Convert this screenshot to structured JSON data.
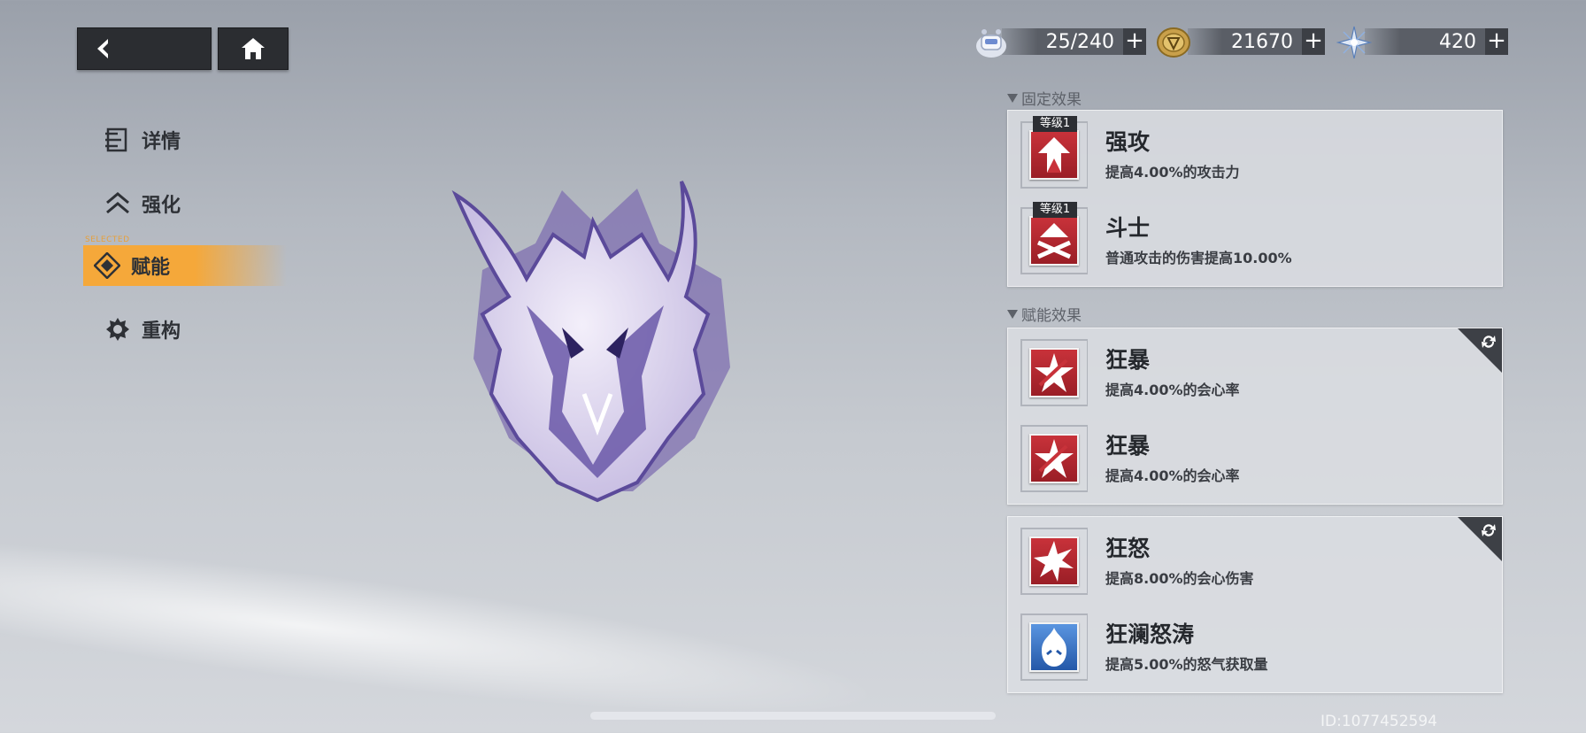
{
  "nav": {
    "back_label": "",
    "home_label": ""
  },
  "resources": [
    {
      "icon": "stamina-robot-icon",
      "value": "25/240"
    },
    {
      "icon": "coin-icon",
      "value": "21670"
    },
    {
      "icon": "crystal-star-icon",
      "value": "420"
    }
  ],
  "sidebar": {
    "items": [
      {
        "label": "详情",
        "icon": "details-list-icon"
      },
      {
        "label": "强化",
        "icon": "upgrade-chevron-icon"
      },
      {
        "label": "赋能",
        "icon": "empower-icon",
        "active": true
      },
      {
        "label": "重构",
        "icon": "rebuild-gear-icon"
      }
    ],
    "active_tag": "SELECTED"
  },
  "fixed_section": {
    "title": "固定效果",
    "entries": [
      {
        "level": "等级1",
        "name": "强攻",
        "desc": "提高4.00%的攻击力",
        "icon": "attack-up-arrow-icon"
      },
      {
        "level": "等级1",
        "name": "斗士",
        "desc": "普通攻击的伤害提高10.00%",
        "icon": "fighter-icon"
      }
    ]
  },
  "empower_section": {
    "title": "赋能效果",
    "groups": [
      {
        "entries": [
          {
            "name": "狂暴",
            "desc": "提高4.00%的会心率",
            "icon": "crit-star-icon"
          },
          {
            "name": "狂暴",
            "desc": "提高4.00%的会心率",
            "icon": "crit-star-icon"
          }
        ]
      },
      {
        "entries": [
          {
            "name": "狂怒",
            "desc": "提高8.00%的会心伤害",
            "icon": "crit-damage-star-icon"
          },
          {
            "name": "狂澜怒涛",
            "desc": "提高5.00%的怒气获取量",
            "icon": "rage-flame-icon"
          }
        ]
      }
    ]
  },
  "footer": {
    "uid": "ID:1077452594"
  },
  "colors": {
    "accent": "#f5a83a",
    "red_icon": "#b8282e",
    "blue_icon": "#2f6fc4",
    "dark": "#2b2d31"
  }
}
